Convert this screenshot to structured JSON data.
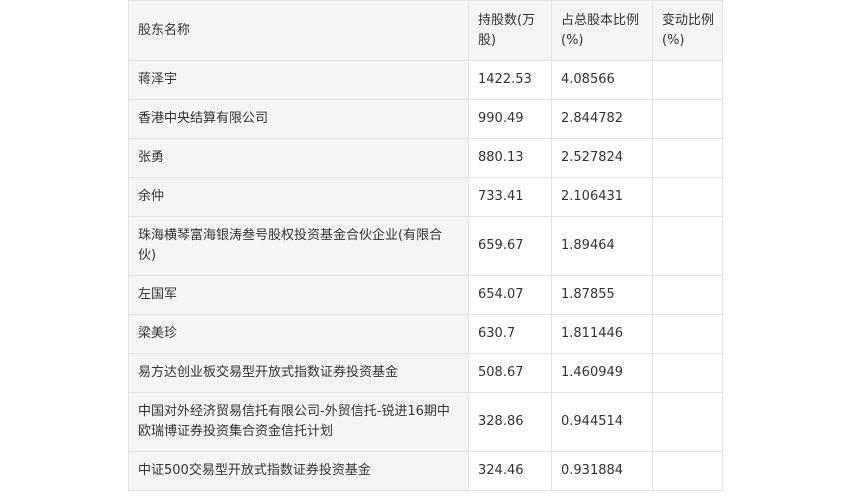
{
  "headers": [
    "股东名称",
    "持股数(万股)",
    "占总股本比例(%)",
    "变动比例(%)"
  ],
  "rows": [
    {
      "name": "蒋泽宇",
      "shares": "1422.53",
      "ratio": "4.08566",
      "change": ""
    },
    {
      "name": "香港中央结算有限公司",
      "shares": "990.49",
      "ratio": "2.844782",
      "change": ""
    },
    {
      "name": "张勇",
      "shares": "880.13",
      "ratio": "2.527824",
      "change": ""
    },
    {
      "name": "余仲",
      "shares": "733.41",
      "ratio": "2.106431",
      "change": ""
    },
    {
      "name": "珠海横琴富海银涛叁号股权投资基金合伙企业(有限合伙)",
      "shares": "659.67",
      "ratio": "1.89464",
      "change": ""
    },
    {
      "name": "左国军",
      "shares": "654.07",
      "ratio": "1.87855",
      "change": ""
    },
    {
      "name": "梁美珍",
      "shares": "630.7",
      "ratio": "1.811446",
      "change": ""
    },
    {
      "name": "易方达创业板交易型开放式指数证券投资基金",
      "shares": "508.67",
      "ratio": "1.460949",
      "change": ""
    },
    {
      "name": "中国对外经济贸易信托有限公司-外贸信托-锐进16期中欧瑞博证券投资集合资金信托计划",
      "shares": "328.86",
      "ratio": "0.944514",
      "change": ""
    },
    {
      "name": "中证500交易型开放式指数证券投资基金",
      "shares": "324.46",
      "ratio": "0.931884",
      "change": ""
    }
  ]
}
